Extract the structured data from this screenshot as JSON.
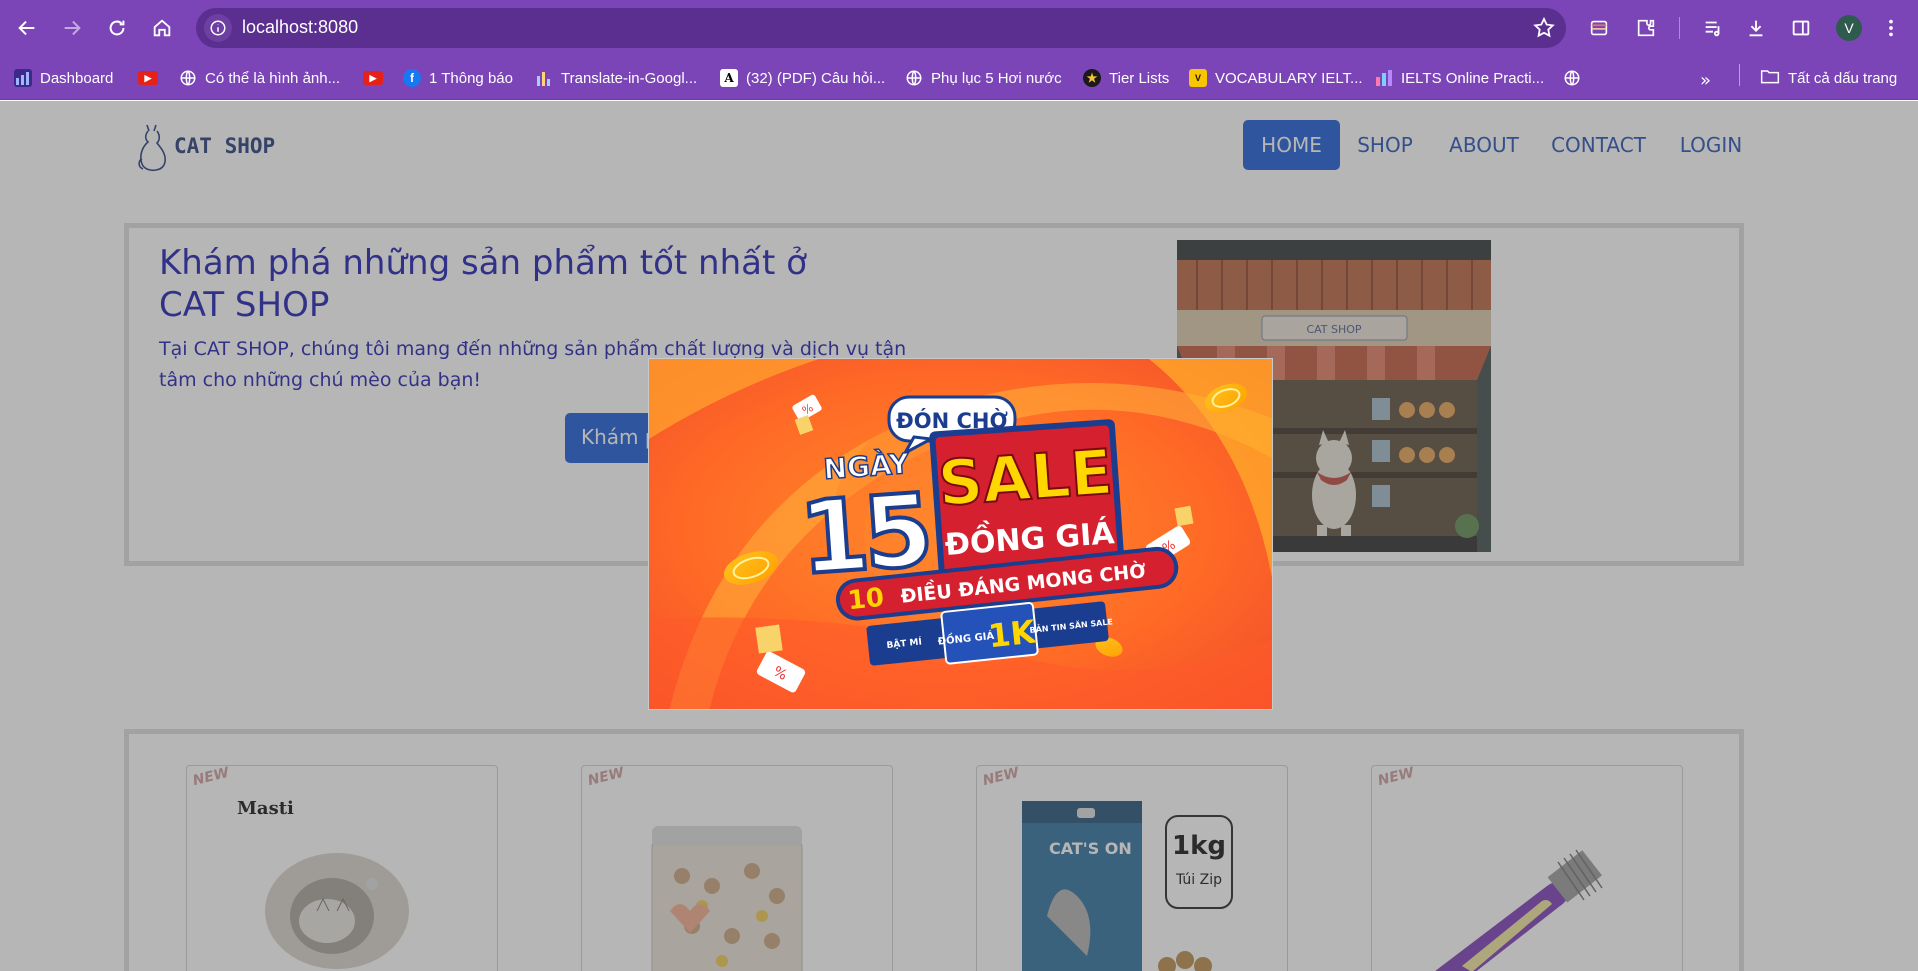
{
  "browser": {
    "url": "localhost:8080",
    "avatar_letter": "V",
    "bookmarks": [
      {
        "label": "Dashboard",
        "icon": "dashboard-icon"
      },
      {
        "label": "",
        "icon": "youtube-icon"
      },
      {
        "label": "Có thể là hình ảnh...",
        "icon": "globe-icon"
      },
      {
        "label": "",
        "icon": "youtube-icon"
      },
      {
        "label": "1 Thông báo",
        "icon": "facebook-icon"
      },
      {
        "label": "Translate-in-Googl...",
        "icon": "chart-icon"
      },
      {
        "label": "(32) (PDF) Câu hỏi...",
        "icon": "academia-icon"
      },
      {
        "label": "Phụ lục 5 Hơi nước",
        "icon": "globe-icon"
      },
      {
        "label": "Tier Lists",
        "icon": "tierlist-icon"
      },
      {
        "label": "VOCABULARY IELT...",
        "icon": "vocab-icon"
      },
      {
        "label": "IELTS Online Practi...",
        "icon": "ielts-icon"
      },
      {
        "label": "",
        "icon": "globe-icon"
      }
    ],
    "all_bookmarks": "Tất cả dấu trang"
  },
  "site": {
    "logo": "CAT SHOP",
    "nav": [
      "HOME",
      "SHOP",
      "ABOUT",
      "CONTACT",
      "LOGIN"
    ],
    "active_nav": "HOME"
  },
  "hero": {
    "title": "Khám phá những sản phẩm tốt nhất ở CAT SHOP",
    "description": "Tại CAT SHOP, chúng tôi mang đến những sản phẩm chất lượng và dịch vụ tận tâm cho những chú mèo của bạn!",
    "button": "Khám phá ngay",
    "image_sign": "CAT SHOP"
  },
  "products": {
    "badge": "NEW",
    "cards": [
      {
        "brand": "Masti"
      },
      {
        "brand": ""
      },
      {
        "brand": "CAT'S ON",
        "weight": "1kg",
        "pack": "Túi Zip"
      },
      {
        "brand": ""
      }
    ]
  },
  "popup": {
    "top_tag": "ĐÓN CHỜ",
    "day_label": "NGÀY",
    "day_number": "15",
    "sale": "SALE",
    "sale_sub": "ĐỒNG GIÁ",
    "ribbon_num": "10",
    "ribbon_text": "ĐIỀU ĐÁNG MONG CHỜ",
    "pill_left": "BẬT MÍ",
    "pill_mid": "ĐỒNG GIÁ",
    "pill_price": "1K",
    "pill_right": "BẢN TIN SĂN SALE"
  }
}
